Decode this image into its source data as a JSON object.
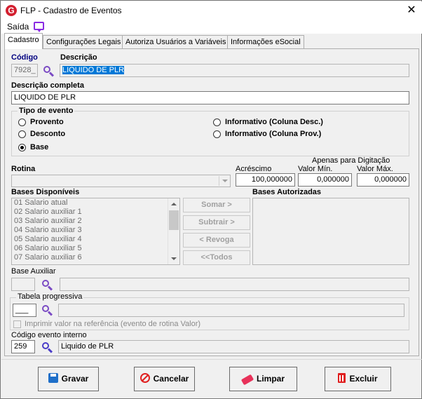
{
  "window": {
    "title": "FLP - Cadastro de Eventos",
    "close_glyph": "✕",
    "logo_letter": "G"
  },
  "menu": {
    "saida": "Saída"
  },
  "tabs": [
    {
      "label": "Cadastro",
      "active": true
    },
    {
      "label": "Configurações Legais",
      "active": false
    },
    {
      "label": "Autoriza Usuários a Variáveis",
      "active": false
    },
    {
      "label": "Informações eSocial",
      "active": false
    }
  ],
  "form": {
    "codigo_label": "Código",
    "codigo_value": "7928_",
    "descricao_label": "Descrição",
    "descricao_value": "LIQUIDO DE PLR",
    "descricao_completa_label": "Descrição completa",
    "descricao_completa_value": "LIQUIDO DE PLR",
    "tipo_evento": {
      "label": "Tipo de evento",
      "options": [
        "Provento",
        "Desconto",
        "Base",
        "Informativo (Coluna Desc.)",
        "Informativo (Coluna Prov.)"
      ],
      "selected": "Base"
    },
    "apenas_digitacao_label": "Apenas para Digitação",
    "rotina_label": "Rotina",
    "rotina_value": "",
    "acrescimo_label": "Acréscimo",
    "acrescimo_value": "100,000000",
    "valor_min_label": "Valor Mín.",
    "valor_min_value": "0,000000",
    "valor_max_label": "Valor Máx.",
    "valor_max_value": "0,000000",
    "bases_disponiveis_label": "Bases Disponíveis",
    "bases_disponiveis": [
      "01 Salario atual",
      "02 Salario auxiliar 1",
      "03 Salario auxiliar 2",
      "04 Salario auxiliar 3",
      "05 Salario auxiliar 4",
      "06 Salario auxiliar 5",
      "07 Salario auxiliar 6"
    ],
    "bases_autorizadas_label": "Bases Autorizadas",
    "buttons_transfer": {
      "somar": "Somar >",
      "subtrair": "Subtrair >",
      "revoga": "< Revoga",
      "todos": "<<Todos"
    },
    "base_auxiliar_label": "Base Auxiliar",
    "base_auxiliar_code": "",
    "base_auxiliar_desc": "",
    "tabela_progressiva_label": "Tabela progressiva",
    "tabela_progressiva_code": "___",
    "tabela_progressiva_desc": "",
    "imprimir_label": "Imprimir valor na referência (evento de rotina Valor)",
    "codigo_evento_interno_label": "Código evento interno",
    "codigo_evento_interno_value": "259",
    "codigo_evento_interno_desc": "Liquido de PLR"
  },
  "actions": {
    "gravar": "Gravar",
    "cancelar": "Cancelar",
    "limpar": "Limpar",
    "excluir": "Excluir"
  },
  "colors": {
    "accent_purple": "#7b4bc4",
    "selection_blue": "#0078d7",
    "navy_label": "#000080",
    "logo_red": "#d32030"
  }
}
